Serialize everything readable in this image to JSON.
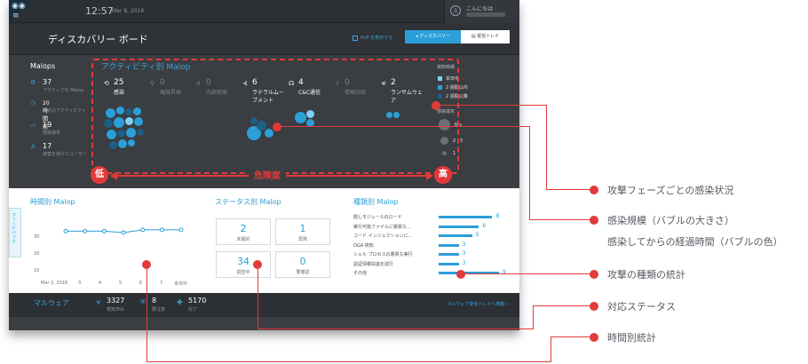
{
  "topbar": {
    "clock": "12:57",
    "date": "Mar 8, 2018",
    "user_greeting": "こんにちは",
    "logo_icon": "cybereason-owl-icon",
    "menu_icon": "hamburger-icon"
  },
  "titlebar": {
    "title": "ディスカバリー ボード",
    "pup_label": "PUP を表示する",
    "discovery_label": "ディスカバリー",
    "inbox_label": "受信トレイ"
  },
  "malops": {
    "title": "Malops",
    "stats": [
      {
        "icon": "gear-icon",
        "value": "37",
        "label": "アクティブな Malop"
      },
      {
        "icon": "clock-icon",
        "value": "20時間前",
        "label": "最近のアクティビティ"
      },
      {
        "icon": "monitor-icon",
        "value": "19",
        "label": "感染端末"
      },
      {
        "icon": "user-icon",
        "value": "17",
        "label": "被害を受けたユーザー"
      }
    ]
  },
  "activity": {
    "title": "アクティビティ別 Malop",
    "phases": [
      {
        "icon": "infection-icon",
        "value": "25",
        "label": "感染",
        "active": true
      },
      {
        "icon": "privilege-icon",
        "value": "0",
        "label": "権限昇格",
        "active": false
      },
      {
        "icon": "recon-icon",
        "value": "0",
        "label": "内部探索",
        "active": false
      },
      {
        "icon": "lateral-icon",
        "value": "6",
        "label": "ラテラルムー\nブメント",
        "active": true
      },
      {
        "icon": "c2-icon",
        "value": "4",
        "label": "C&C通信",
        "active": true
      },
      {
        "icon": "exfil-icon",
        "value": "0",
        "label": "情報窃取",
        "active": false
      },
      {
        "icon": "ransom-icon",
        "value": "2",
        "label": "ランサムウェ\nア",
        "active": true
      }
    ]
  },
  "legend": {
    "time_title": "検知時期",
    "time_items": [
      {
        "label": "本日中",
        "color": "#7fd0f5"
      },
      {
        "label": "2 週間以内",
        "color": "#2a9fd8"
      },
      {
        "label": "2 週間以降",
        "color": "#1d5f86"
      }
    ],
    "size_title": "感染端末",
    "size_items": [
      "6 +",
      "2 - 5",
      "1"
    ]
  },
  "risk": {
    "low": "低",
    "high": "高",
    "label": "危険度"
  },
  "timeline": {
    "title": "時間別 Malop",
    "feedback": "フィードバック",
    "y_ticks": [
      "30",
      "20",
      "10"
    ],
    "x_labels": [
      "Mar 2, 2018",
      "3",
      "4",
      "5",
      "6",
      "7",
      "本日中"
    ],
    "values": [
      32,
      32,
      32,
      31,
      33,
      33,
      33
    ]
  },
  "status": {
    "title": "ステータス別 Malop",
    "boxes": [
      {
        "value": "2",
        "label": "未開封"
      },
      {
        "value": "1",
        "label": "再発"
      },
      {
        "value": "34",
        "label": "調査中"
      },
      {
        "value": "0",
        "label": "要確認"
      }
    ]
  },
  "types": {
    "title": "種類別 Malop",
    "rows": [
      {
        "label": "隠しモジュールのロード",
        "value": "8"
      },
      {
        "label": "実行可能ファイルに悪質な...",
        "value": "6"
      },
      {
        "label": "コード インジェクションに...",
        "value": "5"
      },
      {
        "label": "DGA 検知",
        "value": "3"
      },
      {
        "label": "シェル プロセスの悪質な実行",
        "value": "3"
      },
      {
        "label": "認証情報窃盗を試行",
        "value": "3"
      },
      {
        "label": "その他",
        "value": "9"
      }
    ]
  },
  "malware": {
    "title": "マルウェア",
    "stats": [
      {
        "icon": "biohazard-icon",
        "value": "3327",
        "label": "検知済み"
      },
      {
        "icon": "shield-icon",
        "value": "8",
        "label": "要注意"
      },
      {
        "icon": "plus-icon",
        "value": "5170",
        "label": "完了"
      }
    ],
    "link": "マルウェア受信トレイへ移動 »"
  },
  "callouts": [
    "攻撃フェーズごとの感染状況",
    "感染規模（バブルの大きさ）",
    "感染してからの経過時間（バブルの色）",
    "攻撃の種類の統計",
    "対応ステータス",
    "時間別統計"
  ]
}
